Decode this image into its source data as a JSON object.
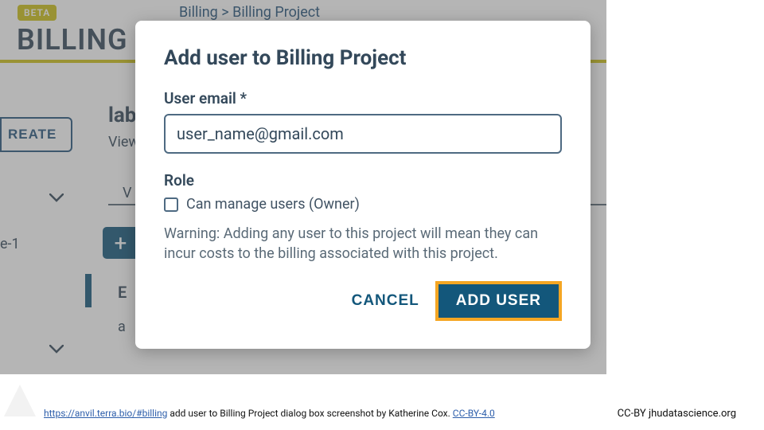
{
  "header": {
    "beta_badge": "BETA",
    "title": "BILLING",
    "breadcrumb": "Billing > Billing Project"
  },
  "background": {
    "create_button": "REATE",
    "lab": "lab",
    "view": "View",
    "side_item": "e-1",
    "v_text": "V",
    "plus": "+",
    "e_text": "E",
    "a_text": "a"
  },
  "modal": {
    "title": "Add user to Billing Project",
    "email_label": "User email *",
    "email_value": "user_name@gmail.com",
    "role_label": "Role",
    "checkbox_label": "Can manage users (Owner)",
    "warning": "Warning: Adding any user to this project will mean they can incur costs to the billing associated with this project.",
    "cancel": "CANCEL",
    "add_user": "ADD USER"
  },
  "footer": {
    "url": "https://anvil.terra.bio/#billing",
    "caption": " add user to Billing Project dialog box screenshot by Katherine Cox. ",
    "license_text": "CC-BY-4.0",
    "right": "CC-BY  jhudatascience.org"
  }
}
